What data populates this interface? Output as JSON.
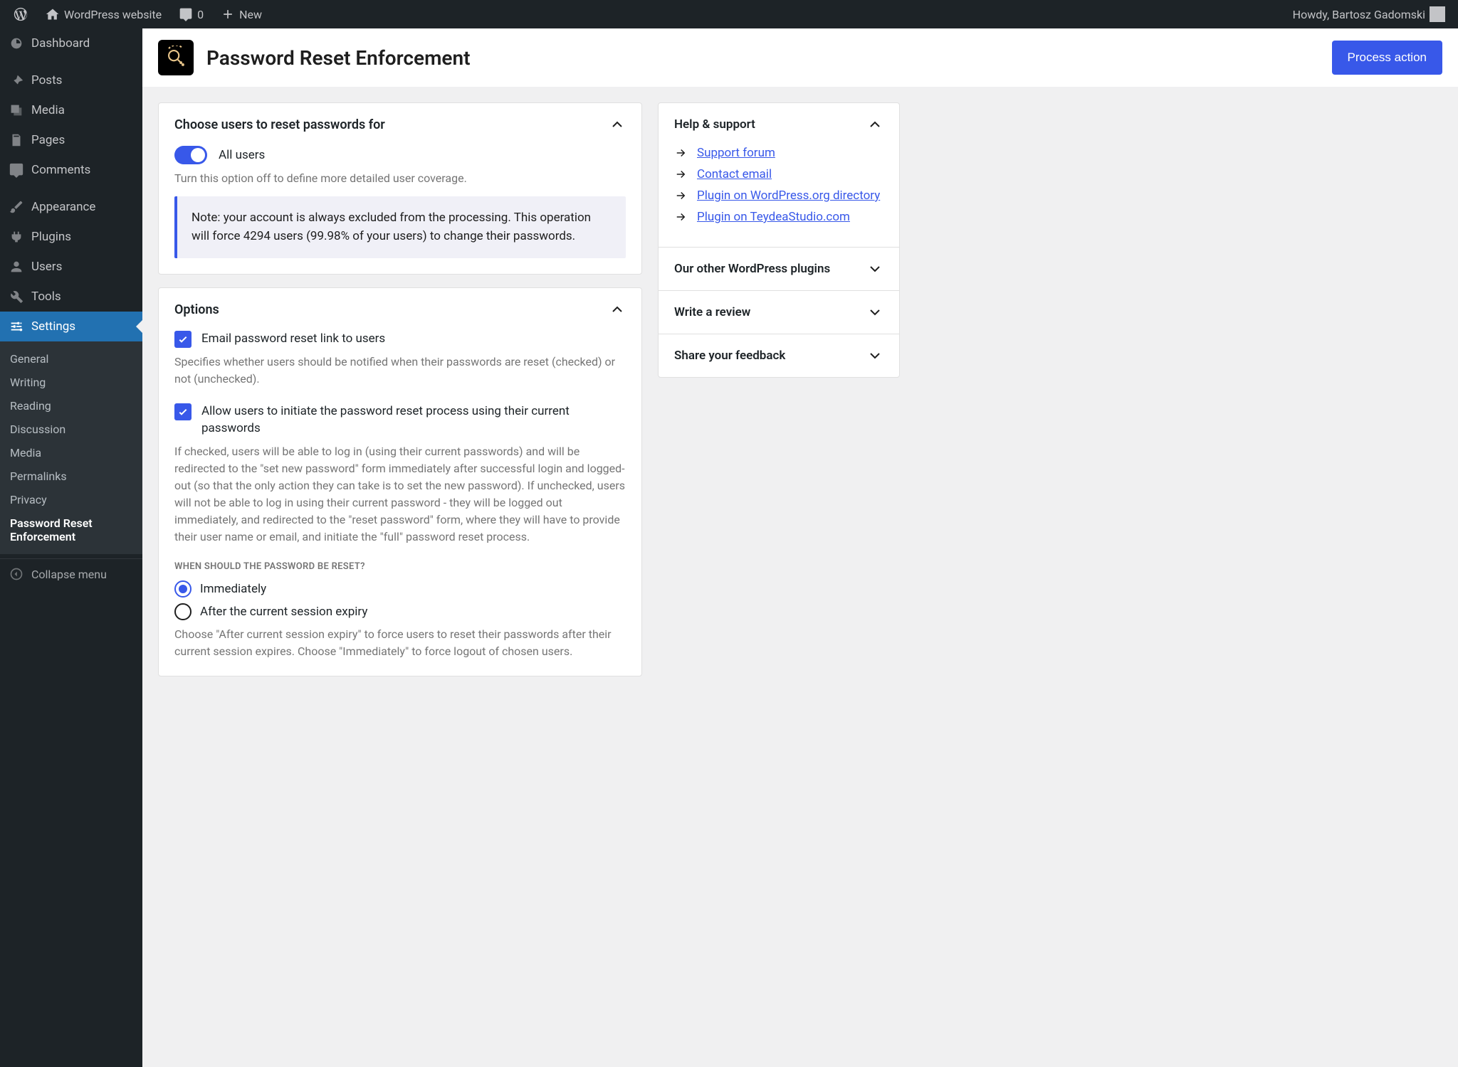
{
  "topbar": {
    "site_name": "WordPress website",
    "comments_count": "0",
    "new_label": "New",
    "greeting": "Howdy, Bartosz Gadomski"
  },
  "sidebar": {
    "items": [
      {
        "label": "Dashboard",
        "icon": "dashboard"
      },
      {
        "label": "Posts",
        "icon": "posts"
      },
      {
        "label": "Media",
        "icon": "media"
      },
      {
        "label": "Pages",
        "icon": "pages"
      },
      {
        "label": "Comments",
        "icon": "comments"
      },
      {
        "label": "Appearance",
        "icon": "appearance"
      },
      {
        "label": "Plugins",
        "icon": "plugins"
      },
      {
        "label": "Users",
        "icon": "users"
      },
      {
        "label": "Tools",
        "icon": "tools"
      },
      {
        "label": "Settings",
        "icon": "settings"
      }
    ],
    "submenu": [
      {
        "label": "General"
      },
      {
        "label": "Writing"
      },
      {
        "label": "Reading"
      },
      {
        "label": "Discussion"
      },
      {
        "label": "Media"
      },
      {
        "label": "Permalinks"
      },
      {
        "label": "Privacy"
      },
      {
        "label": "Password Reset Enforcement"
      }
    ],
    "collapse_label": "Collapse menu"
  },
  "header": {
    "title": "Password Reset Enforcement",
    "action_button": "Process action"
  },
  "panels": {
    "choose_users": {
      "title": "Choose users to reset passwords for",
      "toggle_label": "All users",
      "help": "Turn this option off to define more detailed user coverage.",
      "notice": "Note: your account is always excluded from the processing. This operation will force 4294 users (99.98% of your users) to change their passwords."
    },
    "options": {
      "title": "Options",
      "email": {
        "label": "Email password reset link to users",
        "desc": "Specifies whether users should be notified when their passwords are reset (checked) or not (unchecked)."
      },
      "allow_current": {
        "label": "Allow users to initiate the password reset process using their current passwords",
        "desc": "If checked, users will be able to log in (using their current passwords) and will be redirected to the \"set new password\" form immediately after successful login and logged-out (so that the only action they can take is to set the new password). If unchecked, users will not be able to log in using their current password - they will be logged out immediately, and redirected to the \"reset password\" form, where they will have to provide their user name or email, and initiate the \"full\" password reset process."
      },
      "when_heading": "When should the password be reset?",
      "radios": {
        "immediately": "Immediately",
        "after_session": "After the current session expiry"
      },
      "when_desc": "Choose \"After current session expiry\" to force users to reset their passwords after their current session expires. Choose \"Immediately\" to force logout of chosen users."
    }
  },
  "sidepanel": {
    "help_title": "Help & support",
    "links": [
      "Support forum",
      "Contact email",
      "Plugin on WordPress.org directory",
      "Plugin on TeydeaStudio.com"
    ],
    "other_plugins": "Our other WordPress plugins",
    "review": "Write a review",
    "feedback": "Share your feedback"
  }
}
